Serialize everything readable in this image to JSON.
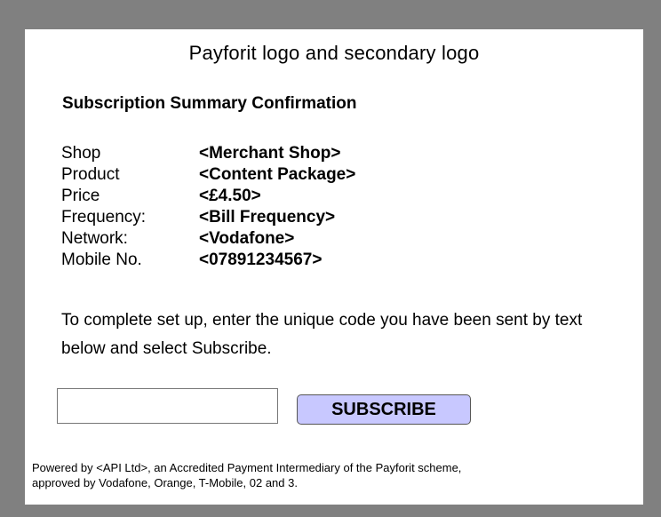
{
  "header": {
    "logo_text": "Payforit logo and secondary logo"
  },
  "summary": {
    "title": "Subscription Summary Confirmation",
    "rows": [
      {
        "label": "Shop",
        "value": "<Merchant Shop>"
      },
      {
        "label": "Product",
        "value": "<Content Package>"
      },
      {
        "label": "Price",
        "value": "<£4.50>"
      },
      {
        "label": "Frequency:",
        "value": "<Bill Frequency>"
      },
      {
        "label": "Network:",
        "value": "<Vodafone>"
      },
      {
        "label": "Mobile No.",
        "value": "<07891234567>"
      }
    ]
  },
  "instructions": "To complete set up, enter the unique code you have been sent by text below and select Subscribe.",
  "form": {
    "code_value": "",
    "code_placeholder": "",
    "subscribe_label": "SUBSCRIBE"
  },
  "footer": {
    "line1": "Powered by <API Ltd>, an Accredited Payment Intermediary of the Payforit scheme,",
    "line2": "approved by Vodafone, Orange, T-Mobile, 02 and 3."
  },
  "colors": {
    "page_background": "#808080",
    "panel_background": "#ffffff",
    "button_background": "#c8c8ff"
  }
}
